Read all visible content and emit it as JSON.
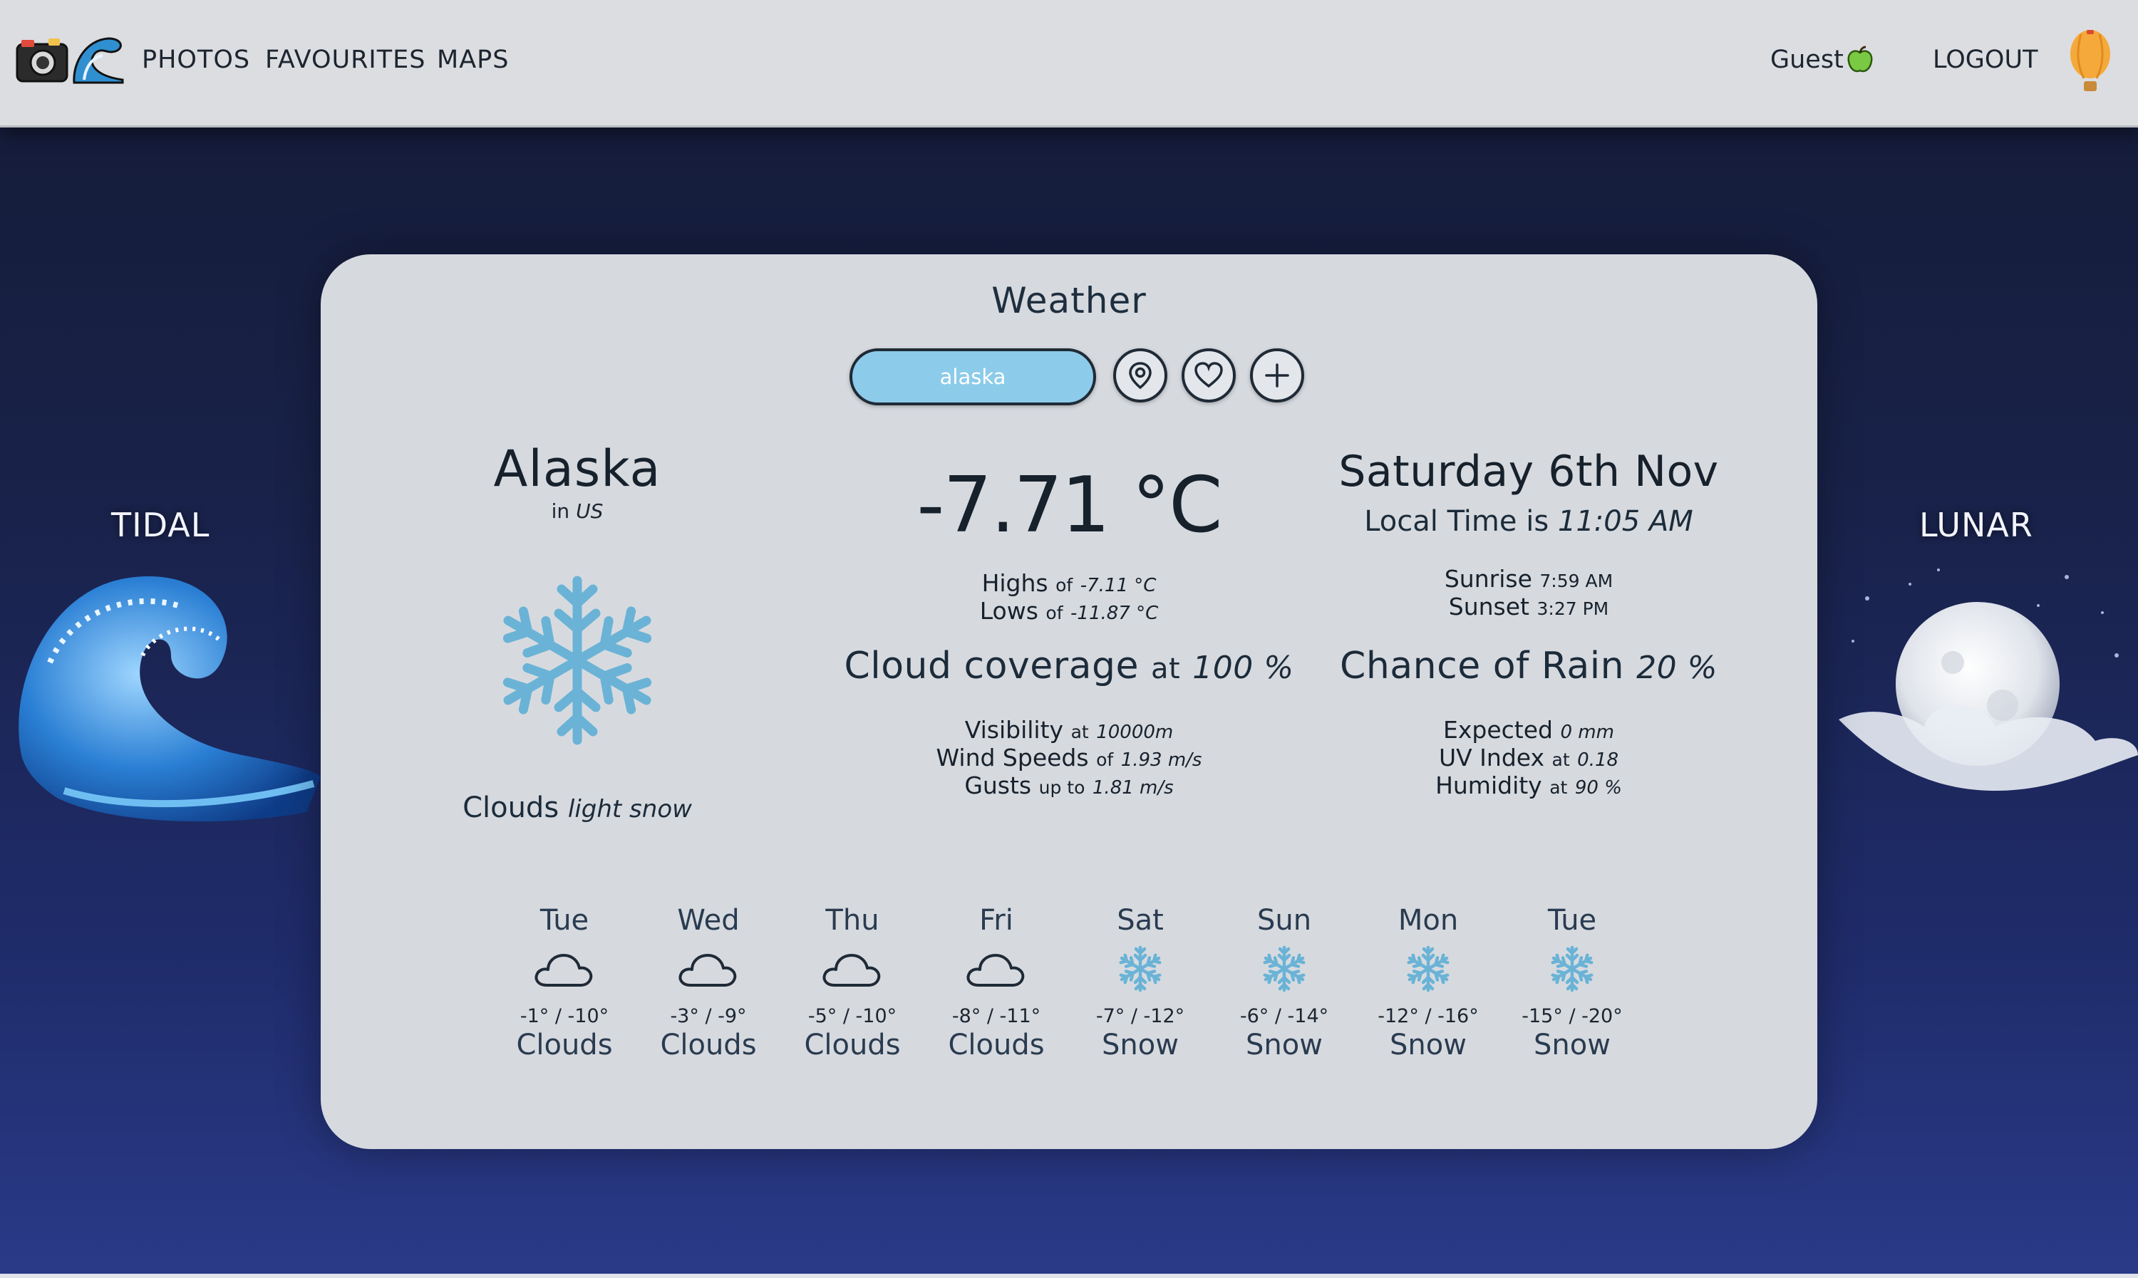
{
  "nav": {
    "links": [
      "PHOTOS",
      "FAVOURITES",
      "MAPS"
    ],
    "user_label": "Guest",
    "logout_label": "LOGOUT"
  },
  "side": {
    "left_label": "TIDAL",
    "right_label": "LUNAR"
  },
  "weather": {
    "title": "Weather",
    "search_value": "alaska",
    "location": {
      "city": "Alaska",
      "in_label": "in",
      "country": "US"
    },
    "temperature": "-7.71 °C",
    "highs": {
      "label": "Highs",
      "of": "of",
      "value": "-7.11 °C"
    },
    "lows": {
      "label": "Lows",
      "of": "of",
      "value": "-11.87 °C"
    },
    "cloud": {
      "label": "Cloud coverage",
      "at": "at",
      "value": "100 %"
    },
    "visibility": {
      "label": "Visibility",
      "at": "at",
      "value": "10000m"
    },
    "wind": {
      "label": "Wind Speeds",
      "of": "of",
      "value": "1.93 m/s"
    },
    "gusts": {
      "label": "Gusts",
      "up_to": "up to",
      "value": "1.81 m/s"
    },
    "date": "Saturday 6th Nov",
    "local_time": {
      "label": "Local Time is",
      "value": "11:05 AM"
    },
    "sunrise": {
      "label": "Sunrise",
      "value": "7:59 AM"
    },
    "sunset": {
      "label": "Sunset",
      "value": "3:27 PM"
    },
    "rain": {
      "label": "Chance of Rain",
      "value": "20 %"
    },
    "expected": {
      "label": "Expected",
      "value": "0 mm"
    },
    "uv": {
      "label": "UV Index",
      "at": "at",
      "value": "0.18"
    },
    "humidity": {
      "label": "Humidity",
      "at": "at",
      "value": "90 %"
    },
    "condition": {
      "main": "Clouds",
      "detail": "light snow"
    },
    "condition_icon": "snowflake-icon",
    "forecast": [
      {
        "day": "Tue",
        "temp": "-1° / -10°",
        "cond": "Clouds",
        "icon": "cloud-icon"
      },
      {
        "day": "Wed",
        "temp": "-3° / -9°",
        "cond": "Clouds",
        "icon": "cloud-icon"
      },
      {
        "day": "Thu",
        "temp": "-5° / -10°",
        "cond": "Clouds",
        "icon": "cloud-icon"
      },
      {
        "day": "Fri",
        "temp": "-8° / -11°",
        "cond": "Clouds",
        "icon": "cloud-icon"
      },
      {
        "day": "Sat",
        "temp": "-7° / -12°",
        "cond": "Snow",
        "icon": "snowflake-icon"
      },
      {
        "day": "Sun",
        "temp": "-6° / -14°",
        "cond": "Snow",
        "icon": "snowflake-icon"
      },
      {
        "day": "Mon",
        "temp": "-12° / -16°",
        "cond": "Snow",
        "icon": "snowflake-icon"
      },
      {
        "day": "Tue",
        "temp": "-15° / -20°",
        "cond": "Snow",
        "icon": "snowflake-icon"
      }
    ]
  },
  "colors": {
    "card": "#d6dadf",
    "search_bg": "#8ccbe9",
    "snow_icon": "#6ab3d6",
    "background": "#19224a"
  }
}
